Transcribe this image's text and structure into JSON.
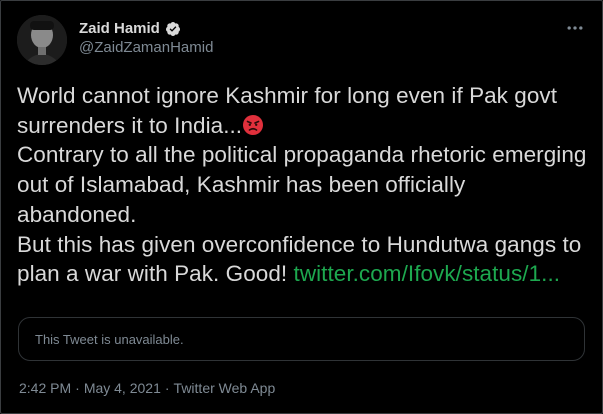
{
  "author": {
    "display_name": "Zaid Hamid",
    "handle": "@ZaidZamanHamid",
    "verified": true,
    "avatar_icon": "profile-photo",
    "verified_icon": "verified-badge-icon"
  },
  "tweet": {
    "line1": "World cannot ignore Kashmir for long even if Pak govt surrenders it to India...",
    "emoji": "angry-face-emoji",
    "line2": "Contrary to all the political propaganda rhetoric emerging out of Islamabad, Kashmir has been officially abandoned.",
    "line3": "But this has given overconfidence to Hundutwa gangs to plan a war with Pak. Good!",
    "link_text": "twitter.com/Ifovk/status/1..."
  },
  "quoted": {
    "unavailable_text": "This Tweet is unavailable."
  },
  "meta": {
    "time": "2:42 PM",
    "date": "May 4, 2021",
    "source": "Twitter Web App",
    "separator": "·"
  },
  "colors": {
    "background": "#000000",
    "text": "#d9d9d9",
    "secondary": "#7f8a94",
    "link": "#1da84f",
    "verified": "#d9d9d9"
  }
}
